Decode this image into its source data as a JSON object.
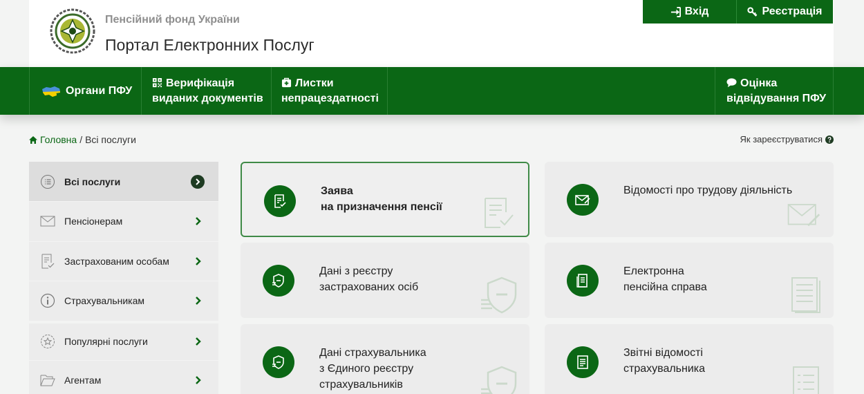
{
  "header": {
    "org_name": "Пенсійний фонд України",
    "portal_name": "Портал Електронних Послуг",
    "login_label": "Вхід",
    "register_label": "Реєстрація"
  },
  "nav": {
    "organs": "Органи ПФУ",
    "verify_line1": "Верифікація",
    "verify_line2": "виданих документів",
    "sick_line1": "Листки",
    "sick_line2": "непрацездатності",
    "rate_line1": "Оцінка",
    "rate_line2": "відвідування ПФУ"
  },
  "breadcrumb": {
    "home": "Головна",
    "separator": "/",
    "current": "Всі послуги"
  },
  "help_link": "Як зареєструватися",
  "sidebar": {
    "items": [
      {
        "label": "Всі послуги"
      },
      {
        "label": "Пенсіонерам"
      },
      {
        "label": "Застрахованим особам"
      },
      {
        "label": "Страхувальникам"
      },
      {
        "label": "Популярні послуги"
      },
      {
        "label": "Агентам"
      }
    ]
  },
  "cards": [
    {
      "line1": "Заява",
      "line2": "на призначення пенсії",
      "line3": ""
    },
    {
      "line1": "Відомості про трудову діяльність",
      "line2": "",
      "line3": ""
    },
    {
      "line1": "Дані з реєстру",
      "line2": "застрахованих осіб",
      "line3": ""
    },
    {
      "line1": "Електронна",
      "line2": "пенсійна справа",
      "line3": ""
    },
    {
      "line1": "Дані страхувальника",
      "line2": "з Єдиного реєстру",
      "line3": "страхувальників"
    },
    {
      "line1": "Звітні відомості",
      "line2": "страхувальника",
      "line3": ""
    }
  ],
  "colors": {
    "brand_green": "#0b6715",
    "background": "#f3f4f3",
    "card_bg": "#ececec"
  }
}
